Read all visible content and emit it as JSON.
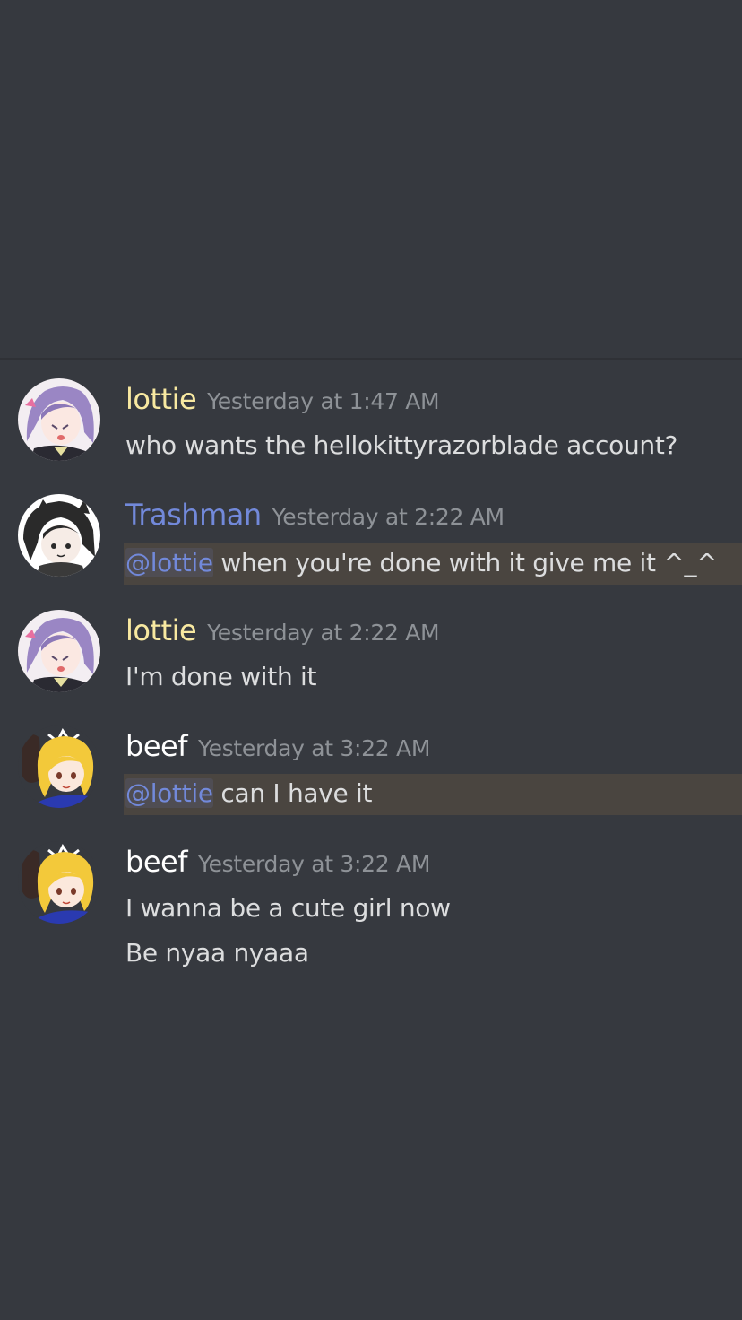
{
  "colors": {
    "background": "#36393f",
    "lottie_name": "#f8e9a1",
    "trashman_name": "#7289da",
    "beef_name": "#ffffff",
    "timestamp": "#8e9297",
    "message_text": "#dcddde",
    "mention": "#7289da",
    "mention_highlight": "#4a4540"
  },
  "messages": [
    {
      "username": "lottie",
      "timestamp": "Yesterday at 1:47 AM",
      "avatar_icon": "anime-purple-hair-avatar-icon",
      "lines": [
        "who wants the hellokittyrazorblade account?"
      ]
    },
    {
      "username": "Trashman",
      "timestamp": "Yesterday at 2:22 AM",
      "avatar_icon": "anime-cat-ears-avatar-icon",
      "mention": "@lottie",
      "mention_text": " when you're done with it give me it ^_^"
    },
    {
      "username": "lottie",
      "timestamp": "Yesterday at 2:22 AM",
      "avatar_icon": "anime-purple-hair-avatar-icon",
      "lines": [
        "I'm done with it"
      ]
    },
    {
      "username": "beef",
      "timestamp": "Yesterday at 3:22 AM",
      "avatar_icon": "anime-blonde-avatar-icon",
      "mention": "@lottie",
      "mention_text": " can I have it"
    },
    {
      "username": "beef",
      "timestamp": "Yesterday at 3:22 AM",
      "avatar_icon": "anime-blonde-avatar-icon",
      "lines": [
        "I wanna be a cute girl now",
        "Be nyaa nyaaa"
      ]
    }
  ]
}
